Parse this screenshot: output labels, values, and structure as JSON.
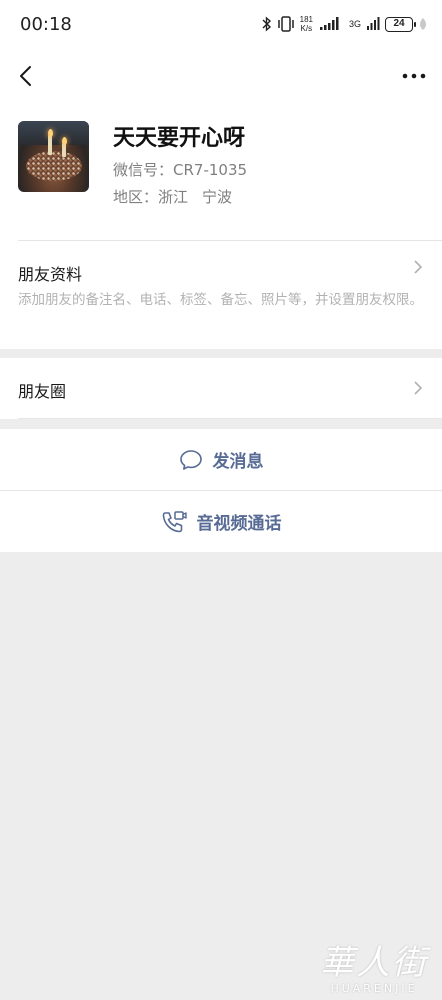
{
  "status_bar": {
    "time": "00:18",
    "speed_value": "181",
    "speed_unit": "K/s",
    "network": "3G",
    "battery": "24"
  },
  "nav": {
    "back_icon": "chevron-left-icon",
    "more_icon": "more-dots-icon"
  },
  "profile": {
    "name": "天天要开心呀",
    "wechat_id": "微信号：CR7-1035",
    "region_label": "地区：",
    "region_province": "浙江",
    "region_city": "宁波"
  },
  "friend_info": {
    "title": "朋友资料",
    "description": "添加朋友的备注名、电话、标签、备忘、照片等，并设置朋友权限。"
  },
  "moments": {
    "title": "朋友圈"
  },
  "actions": {
    "send_message": "发消息",
    "av_call": "音视频通话"
  },
  "watermark": {
    "chinese": "華人街",
    "english": "HUARENJIE"
  },
  "colors": {
    "link_blue": "#576b95",
    "page_bg": "#ededed"
  }
}
